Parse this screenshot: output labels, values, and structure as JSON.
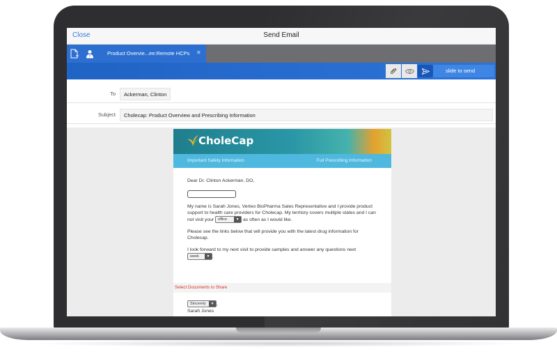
{
  "header": {
    "close_label": "Close",
    "title": "Send Email"
  },
  "tabs": {
    "active_label": "Product Overvie...ee:Remote HCPs",
    "close_glyph": "✕"
  },
  "toolbar": {
    "slide_label": "slide to send",
    "icons": [
      "attach-icon",
      "preview-eye-icon",
      "send-icon"
    ]
  },
  "fields": {
    "to_label": "To",
    "to_value": "Ackerman, Clinton",
    "subject_label": "Subject",
    "subject_value": "Cholecap: Product Overview and Prescribing Information"
  },
  "email": {
    "brand": "CholeCap",
    "links": {
      "safety": "Important Safety Information",
      "prescribing": "Full Prescribing Information"
    },
    "greeting": "Dear Dr. Clinton Ackerman, DO,",
    "para1_a": "My name is Sarah Jones, Verteo BioPharma Sales Representative and I provide product support to health care providers for Cholecap. My territory covers multiple states and I can not visit your",
    "para1_select": "office",
    "para1_b": "as often as I would like.",
    "para2": "Please see the links below that will provide you with the latest drug information for Cholecap.",
    "para3_a": "I look forward to my next visit to provide samples and answer any questions next",
    "para3_select": "week",
    "para3_b": ".",
    "select_docs_label": "Select Documents to Share",
    "closing_select": "Sincerely",
    "closing_comma": ",",
    "signature": "Sarah Jones"
  },
  "colors": {
    "accent_blue": "#2d6fd0",
    "link_red": "#d9302b",
    "teal_header": "#2a97a6",
    "link_bar": "#4fb8df"
  }
}
